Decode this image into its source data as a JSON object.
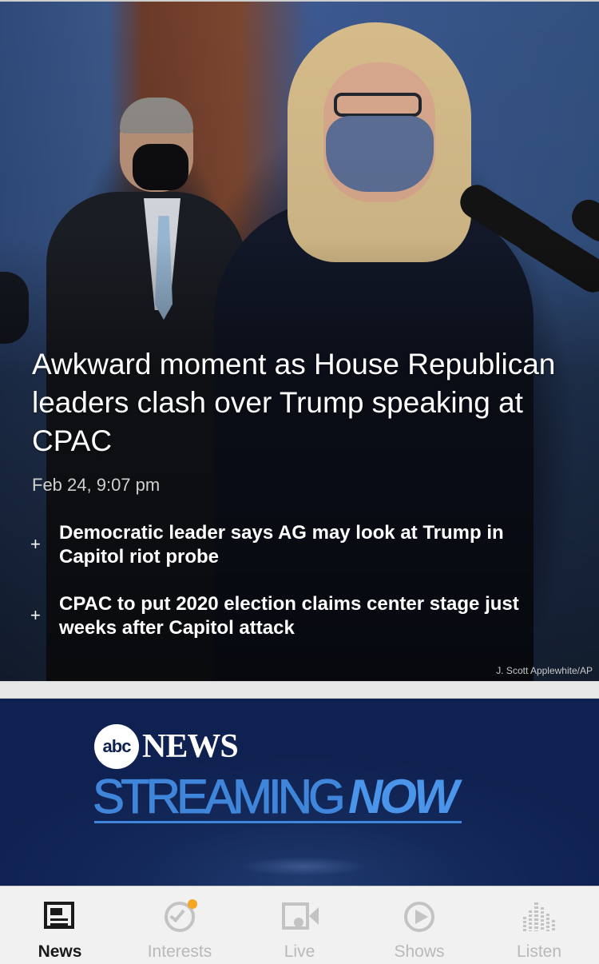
{
  "hero": {
    "headline": "Awkward moment as House Republican leaders clash over Trump speaking at CPAC",
    "timestamp": "Feb 24, 9:07 pm",
    "related": [
      {
        "icon": "plus-icon",
        "text": "Democratic leader says AG may look at Trump in Capitol riot probe"
      },
      {
        "icon": "plus-icon",
        "text": "CPAC to put 2020 election claims center stage just weeks after Capitol attack"
      }
    ],
    "photo_credit": "J. Scott Applewhite/AP"
  },
  "stream_banner": {
    "logo_abc": "abc",
    "logo_news": "NEWS",
    "streaming": "STREAMING",
    "now": "NOW"
  },
  "tabbar": {
    "tabs": [
      {
        "label": "News",
        "icon": "newspaper-icon",
        "active": true
      },
      {
        "label": "Interests",
        "icon": "check-circle-icon",
        "active": false,
        "badge_color": "#f5a623"
      },
      {
        "label": "Live",
        "icon": "video-camera-icon",
        "active": false
      },
      {
        "label": "Shows",
        "icon": "play-circle-icon",
        "active": false
      },
      {
        "label": "Listen",
        "icon": "audio-bars-icon",
        "active": false
      }
    ]
  },
  "colors": {
    "tab_active": "#1a1a1a",
    "tab_inactive": "#b9b9b9",
    "badge": "#f5a623",
    "stream_blue": "#3f86db",
    "stream_bg": "#0f2150"
  }
}
